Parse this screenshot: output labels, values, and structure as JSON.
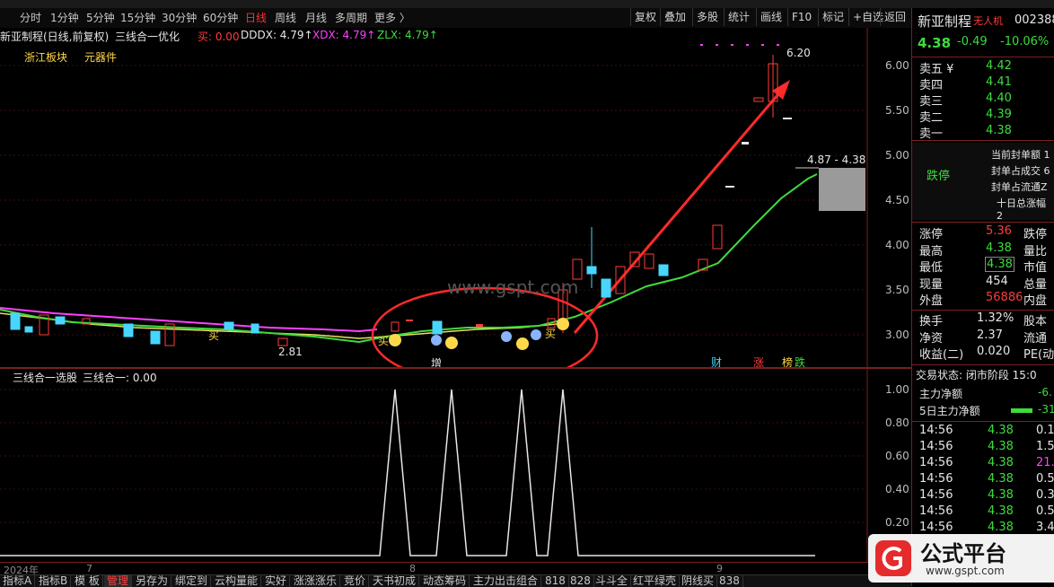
{
  "toolbar": {
    "periods": [
      "分时",
      "1分钟",
      "5分钟",
      "15分钟",
      "30分钟",
      "60分钟",
      "日线",
      "周线",
      "月线",
      "多周期",
      "更多 〉"
    ],
    "active_period": "日线",
    "buttons": [
      "复权",
      "叠加",
      "多股",
      "统计",
      "画线",
      "F10",
      "标记",
      "+自选",
      "返回"
    ]
  },
  "chart_header": {
    "stock": "新亚制程(日线,前复权)",
    "indicator": "三线合一优化",
    "buy_label": "买: 0.00",
    "dddx": "DDDX: 4.79↑",
    "xdx": "XDX: 4.79↑",
    "zlx": "ZLX: 4.79↑",
    "board1": "浙江板块",
    "board2": "元器件"
  },
  "price_axis": [
    "6.00",
    "5.50",
    "5.00",
    "4.50",
    "4.00",
    "3.50",
    "3.00"
  ],
  "annotations": {
    "high": "6.20",
    "low": "2.81",
    "range_box": "4.87 - 4.38",
    "zeng": "增",
    "cai": "财",
    "zhang": "涨",
    "bang": "榜",
    "die": "跌",
    "mai1": "买",
    "mai2": "买",
    "mai3": "买",
    "watermark_site": "www.gspt.com"
  },
  "sub_chart": {
    "title": "三线合一选股",
    "value": "三线合一: 0.00",
    "axis": [
      "1.00",
      "0.80",
      "0.60",
      "0.40",
      "0.20"
    ],
    "signals": [
      {
        "label": "s1",
        "value": 1.0
      },
      {
        "label": "s2",
        "value": 1.0
      },
      {
        "label": "s3",
        "value": 1.0
      },
      {
        "label": "s4",
        "value": 1.0
      }
    ]
  },
  "date_axis": [
    "2024年",
    "7",
    "8",
    "9"
  ],
  "bottom_tabs": [
    "指标A",
    "指标B",
    "模 板",
    "管理",
    "另存为",
    "绑定到",
    "云构量能",
    "实好",
    "涨涨涨乐",
    "竞价",
    "天书初成",
    "动态筹码",
    "主力出击组合",
    "818",
    "828",
    "斗斗全",
    "红平绿壳",
    "阴线买",
    "838"
  ],
  "active_tab": "管理",
  "quote": {
    "name": "新亚制程",
    "tag": "无人机",
    "code": "002388",
    "price": "4.38",
    "change": "-0.49",
    "pct": "-10.06%",
    "asks": [
      {
        "label": "卖五 ¥",
        "price": "4.42"
      },
      {
        "label": "卖四",
        "price": "4.41"
      },
      {
        "label": "卖三",
        "price": "4.40"
      },
      {
        "label": "卖二",
        "price": "4.39"
      },
      {
        "label": "卖一",
        "price": "4.38"
      }
    ],
    "limit_status": "跌停",
    "limit_items": [
      "当前封单额 1",
      "封单占成交 6",
      "封单占流通Z",
      "十日总涨幅 2"
    ],
    "stats": [
      {
        "l1": "涨停",
        "v1": "5.36",
        "l2": "跌停"
      },
      {
        "l1": "最高",
        "v1": "4.38",
        "l2": "量比"
      },
      {
        "l1": "最低",
        "v1": "4.38",
        "l2": "市值"
      },
      {
        "l1": "现量",
        "v1": "454",
        "l2": "总量"
      },
      {
        "l1": "外盘",
        "v1": "56886",
        "l2": "内盘"
      }
    ],
    "stats2": [
      {
        "l1": "换手",
        "v1": "1.32%",
        "l2": "股本"
      },
      {
        "l1": "净资",
        "v1": "2.37",
        "l2": "流通"
      },
      {
        "l1": "收益(二)",
        "v1": "0.020",
        "l2": "PE(动"
      }
    ],
    "trade_state": "交易状态: 闭市阶段 15:0",
    "main_flow_label": "主力净额",
    "main_flow_value": "-6.",
    "flow5_label": "5日主力净额",
    "flow5_value": "-31",
    "ticks": [
      {
        "time": "14:56",
        "price": "4.38",
        "vol": "0.1"
      },
      {
        "time": "14:56",
        "price": "4.38",
        "vol": "1.5"
      },
      {
        "time": "14:56",
        "price": "4.38",
        "vol": "21.9"
      },
      {
        "time": "14:56",
        "price": "4.38",
        "vol": "0.5"
      },
      {
        "time": "14:56",
        "price": "4.38",
        "vol": "0.3"
      },
      {
        "time": "14:56",
        "price": "4.38",
        "vol": "0.5"
      },
      {
        "time": "14:56",
        "price": "4.38",
        "vol": "3.4"
      }
    ]
  },
  "watermark": {
    "text": "公式平台",
    "url": "www.gspt.com"
  }
}
